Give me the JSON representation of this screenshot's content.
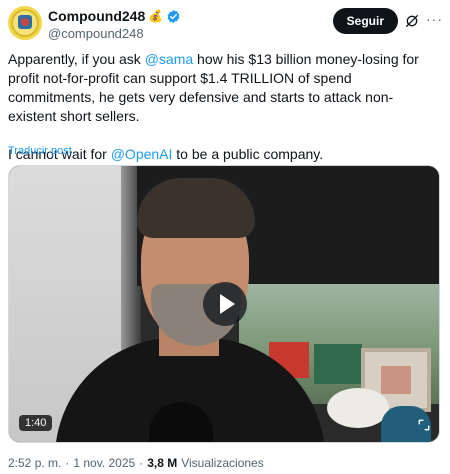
{
  "author": {
    "display_name": "Compound248",
    "badge_emoji": "💰",
    "handle": "@compound248"
  },
  "follow_label": "Seguir",
  "tweet": {
    "seg1": "Apparently, if you ask ",
    "mention1": "@sama",
    "seg2": " how his $13 billion money-losing for profit not-for-profit can support $1.4 TRILLION of spend commitments, he gets very defensive and starts to attack non-existent short sellers.",
    "seg3": "I cannot wait for ",
    "mention2": "@OpenAI",
    "seg4": " to be a public company."
  },
  "translate_label": "Traducir post",
  "video": {
    "duration": "1:40"
  },
  "meta": {
    "time": "2:52 p. m.",
    "sep1": "·",
    "date": "1 nov. 2025",
    "sep2": "·",
    "views_count": "3,8 M",
    "views_label": "Visualizaciones"
  },
  "colors": {
    "accent": "#1d9bf0",
    "text": "#0f1419",
    "muted": "#536471"
  }
}
